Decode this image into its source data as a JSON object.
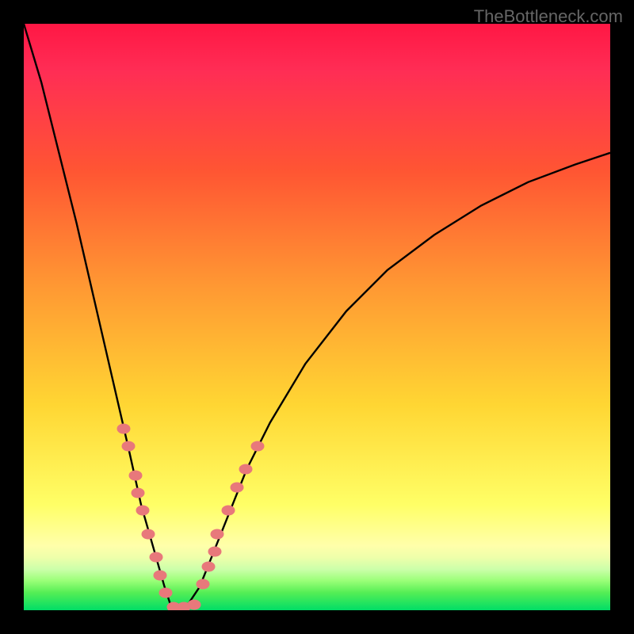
{
  "watermark": "TheBottleneck.com",
  "colors": {
    "background": "#000000",
    "gradient_top": "#ff1744",
    "gradient_mid": "#ffd633",
    "gradient_bottom": "#00dd66",
    "curve": "#000000",
    "markers": "#e8787b"
  },
  "chart_data": {
    "type": "line",
    "title": "",
    "xlabel": "",
    "ylabel": "",
    "xlim": [
      0,
      100
    ],
    "ylim": [
      0,
      100
    ],
    "description": "V-shaped bottleneck curve over rainbow gradient (red=high bottleneck, green=low). Minimum of curve reaches ~0 around x≈26.",
    "series": [
      {
        "name": "bottleneck-curve",
        "x": [
          0,
          3,
          6,
          9,
          12,
          15,
          18,
          20,
          22,
          24,
          25,
          26,
          27,
          28,
          30,
          32,
          34,
          38,
          42,
          48,
          55,
          62,
          70,
          78,
          86,
          94,
          100
        ],
        "y": [
          100,
          90,
          78,
          66,
          53,
          40,
          27,
          18,
          11,
          4,
          1,
          0,
          0,
          1,
          4,
          9,
          14,
          24,
          32,
          42,
          51,
          58,
          64,
          69,
          73,
          76,
          78
        ]
      }
    ],
    "markers": [
      {
        "branch": "left",
        "x": 17.0,
        "y": 31
      },
      {
        "branch": "left",
        "x": 17.8,
        "y": 28
      },
      {
        "branch": "left",
        "x": 19.0,
        "y": 23
      },
      {
        "branch": "left",
        "x": 19.5,
        "y": 20
      },
      {
        "branch": "left",
        "x": 20.3,
        "y": 17
      },
      {
        "branch": "left",
        "x": 21.2,
        "y": 13
      },
      {
        "branch": "left",
        "x": 22.5,
        "y": 9
      },
      {
        "branch": "left",
        "x": 23.3,
        "y": 6
      },
      {
        "branch": "left",
        "x": 24.2,
        "y": 3
      },
      {
        "branch": "base",
        "x": 25.5,
        "y": 0.5
      },
      {
        "branch": "base",
        "x": 27.3,
        "y": 0.5
      },
      {
        "branch": "base",
        "x": 29.0,
        "y": 1
      },
      {
        "branch": "right",
        "x": 30.5,
        "y": 4.5
      },
      {
        "branch": "right",
        "x": 31.5,
        "y": 7.5
      },
      {
        "branch": "right",
        "x": 32.5,
        "y": 10
      },
      {
        "branch": "right",
        "x": 33.0,
        "y": 13
      },
      {
        "branch": "right",
        "x": 34.8,
        "y": 17
      },
      {
        "branch": "right",
        "x": 36.3,
        "y": 21
      },
      {
        "branch": "right",
        "x": 37.8,
        "y": 24
      },
      {
        "branch": "right",
        "x": 39.8,
        "y": 28
      }
    ]
  }
}
